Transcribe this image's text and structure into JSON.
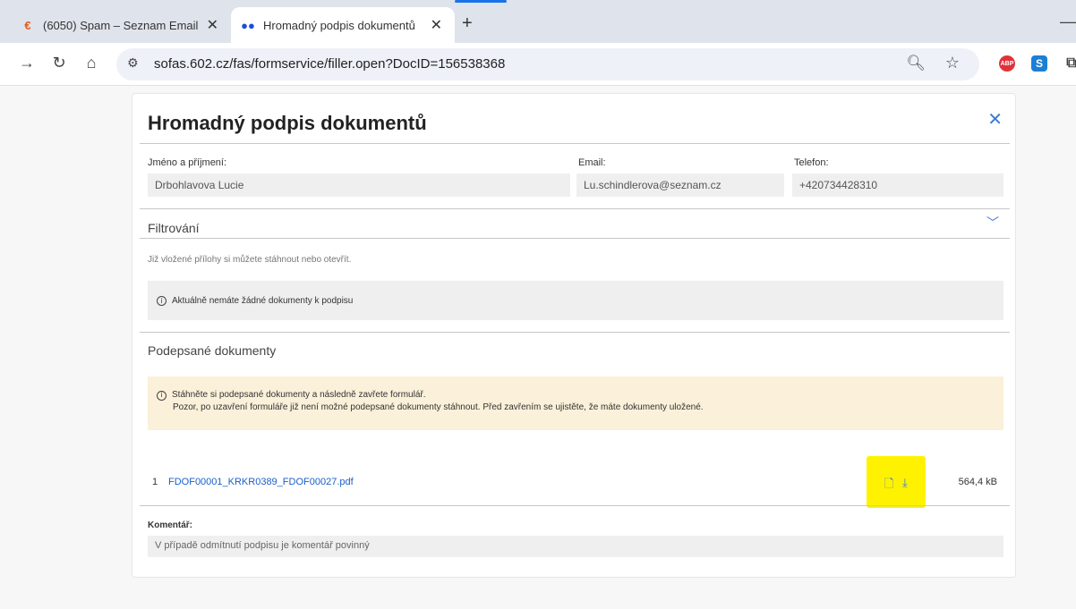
{
  "browser": {
    "tabs": [
      {
        "title": "(6050) Spam – Seznam Email",
        "favicon": "seznam-icon",
        "active": false
      },
      {
        "title": "Hromadný podpis dokumentů",
        "favicon": "flowers-icon",
        "active": true
      }
    ],
    "url": "sofas.602.cz/fas/formservice/filler.open?DocID=156538368",
    "extensions": {
      "abp": "ABP",
      "s": "S"
    }
  },
  "form": {
    "title": "Hromadný podpis dokumentů",
    "fields": {
      "name_label": "Jméno a příjmení:",
      "name_value": "Drbohlavova Lucie",
      "email_label": "Email:",
      "email_value": "Lu.schindlerova@seznam.cz",
      "phone_label": "Telefon:",
      "phone_value": "+420734428310"
    },
    "filter_title": "Filtrování",
    "hint": "Již vložené přílohy si můžete stáhnout nebo otevřít.",
    "no_docs_info": "Aktuálně nemáte žádné dokumenty k podpisu",
    "signed_title": "Podepsané dokumenty",
    "warning_line1": "Stáhněte si podepsané dokumenty a následně zavřete formulář.",
    "warning_line2": "Pozor, po uzavření formuláře již není možné podepsané dokumenty stáhnout. Před zavřením se ujistěte, že máte dokumenty uložené.",
    "documents": [
      {
        "index": "1",
        "filename": "FDOF00001_KRKR0389_FDOF00027.pdf",
        "size": "564,4 kB"
      }
    ],
    "comment_label": "Komentář:",
    "comment_placeholder": "V případě odmítnutí podpisu je komentář povinný"
  }
}
